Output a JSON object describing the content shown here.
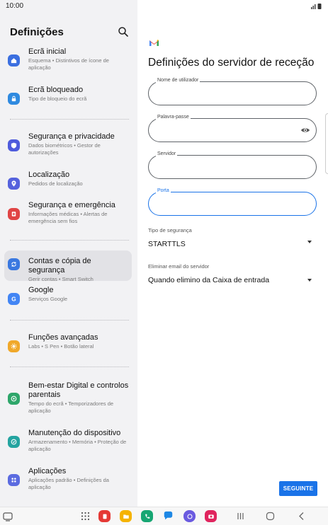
{
  "status_bar": {
    "time": "10:00"
  },
  "settings": {
    "title": "Definições",
    "items": [
      {
        "title": "Ecrã inicial",
        "subtitle": "Esquema • Distintivos de ícone de aplicação",
        "icon": "home-icon",
        "color": "#3b6fe0"
      },
      {
        "title": "Ecrã bloqueado",
        "subtitle": "Tipo de bloqueio do ecrã",
        "icon": "lock-icon",
        "color": "#2f8ae0"
      },
      {
        "title": "Segurança e privacidade",
        "subtitle": "Dados biométricos • Gestor de autorizações",
        "icon": "shield-icon",
        "color": "#4e5bdc"
      },
      {
        "title": "Localização",
        "subtitle": "Pedidos de localização",
        "icon": "location-icon",
        "color": "#5562dd"
      },
      {
        "title": "Segurança e emergência",
        "subtitle": "Informações médicas • Alertas de emergência sem fios",
        "icon": "emergency-icon",
        "color": "#e04444"
      },
      {
        "title": "Contas e cópia de segurança",
        "subtitle": "Gerir contas • Smart Switch",
        "icon": "sync-icon",
        "color": "#3a78e0"
      },
      {
        "title": "Google",
        "subtitle": "Serviços Google",
        "icon": "google-icon",
        "color": "#4285f4"
      },
      {
        "title": "Funções avançadas",
        "subtitle": "Labs • S Pen • Botão lateral",
        "icon": "advanced-features-icon",
        "color": "#f0a82a"
      },
      {
        "title": "Bem-estar Digital e controlos parentais",
        "subtitle": "Tempo do ecrã • Temporizadores de aplicação",
        "icon": "wellbeing-icon",
        "color": "#2ea66a"
      },
      {
        "title": "Manutenção do dispositivo",
        "subtitle": "Armazenamento • Memória • Proteção de aplicação",
        "icon": "device-care-icon",
        "color": "#24a4a0"
      },
      {
        "title": "Aplicações",
        "subtitle": "Aplicações padrão • Definições da aplicação",
        "icon": "apps-icon",
        "color": "#5b6be0"
      }
    ]
  },
  "server": {
    "title": "Definições do servidor de receção",
    "fields": {
      "username": {
        "label": "Nome de utilizador",
        "value": ""
      },
      "password": {
        "label": "Palavra-passe",
        "value": ""
      },
      "server": {
        "label": "Servidor",
        "value": ""
      },
      "port": {
        "label": "Porta",
        "value": ""
      }
    },
    "security": {
      "label": "Tipo de segurança",
      "value": "STARTTLS"
    },
    "delete": {
      "label": "Eliminar email do servidor",
      "value": "Quando elimino da Caixa de entrada"
    },
    "next_label": "SEGUINTE"
  },
  "colors": {
    "accent": "#1a73e8",
    "left_bg": "#f2f2f4",
    "selected_bg": "#e2e2e6"
  },
  "navbar": {
    "apps": [
      {
        "name": "app-drawer-icon"
      },
      {
        "name": "app-red-icon",
        "color": "#e53935"
      },
      {
        "name": "my-files-icon",
        "color": "#f5b300"
      },
      {
        "name": "phone-app-icon",
        "color": "#17a673"
      },
      {
        "name": "messages-icon",
        "color": "#1e88e5"
      },
      {
        "name": "internet-icon",
        "color": "#6a5ae0"
      },
      {
        "name": "camera-icon",
        "color": "#e0245e"
      }
    ]
  }
}
